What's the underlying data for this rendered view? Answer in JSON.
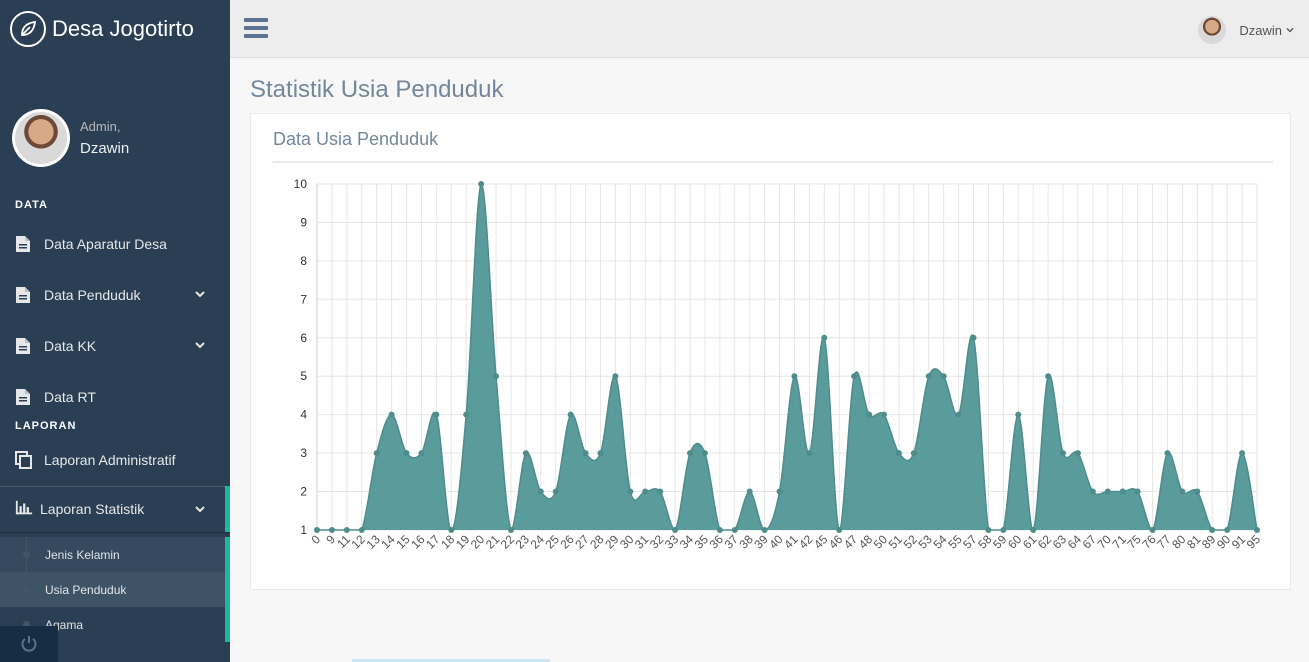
{
  "brand": {
    "name": "Desa Jogotirto"
  },
  "profile": {
    "welcome": "Admin,",
    "name": "Dzawin"
  },
  "sidebar": {
    "section_data": "DATA",
    "section_laporan": "LAPORAN",
    "items": [
      {
        "label": "Data Aparatur Desa",
        "icon": "file-icon"
      },
      {
        "label": "Data Penduduk",
        "icon": "file-icon"
      },
      {
        "label": "Data KK",
        "icon": "file-icon"
      },
      {
        "label": "Data RT",
        "icon": "file-icon"
      },
      {
        "label": "Laporan Administratif",
        "icon": "copy-icon"
      },
      {
        "label": "Laporan Statistik",
        "icon": "bar-chart-icon"
      }
    ],
    "submenu": [
      {
        "label": "Jenis Kelamin"
      },
      {
        "label": "Usia Penduduk"
      },
      {
        "label": "Agama"
      }
    ]
  },
  "topnav": {
    "user": "Dzawin"
  },
  "page": {
    "title": "Statistik Usia Penduduk",
    "panel_title": "Data Usia Penduduk"
  },
  "colors": {
    "sidebar": "#2a3f54",
    "accent": "#1ABB9C",
    "area_fill": "#5a9b9b",
    "area_line": "#4f8c8c"
  },
  "chart_data": {
    "type": "area",
    "title": "",
    "xlabel": "",
    "ylabel": "",
    "ylim": [
      1,
      10
    ],
    "yticks": [
      1,
      2,
      3,
      4,
      5,
      6,
      7,
      8,
      9,
      10
    ],
    "grid": true,
    "smooth": true,
    "x": [
      "0",
      "9",
      "11",
      "12",
      "13",
      "14",
      "15",
      "16",
      "17",
      "18",
      "19",
      "20",
      "21",
      "22",
      "23",
      "24",
      "25",
      "26",
      "27",
      "28",
      "29",
      "30",
      "31",
      "32",
      "33",
      "34",
      "35",
      "36",
      "37",
      "38",
      "39",
      "40",
      "41",
      "42",
      "45",
      "46",
      "47",
      "48",
      "50",
      "51",
      "52",
      "53",
      "54",
      "55",
      "57",
      "58",
      "59",
      "60",
      "61",
      "62",
      "63",
      "64",
      "67",
      "70",
      "71",
      "75",
      "76",
      "77",
      "80",
      "81",
      "89",
      "90",
      "91",
      "95"
    ],
    "series": [
      {
        "values": [
          1,
          1,
          1,
          1,
          3,
          4,
          3,
          3,
          4,
          1,
          4,
          10,
          5,
          1,
          3,
          2,
          2,
          4,
          3,
          3,
          5,
          2,
          2,
          2,
          1,
          3,
          3,
          1,
          1,
          2,
          1,
          2,
          5,
          3,
          6,
          1,
          5,
          4,
          4,
          3,
          3,
          5,
          5,
          4,
          6,
          1,
          1,
          4,
          1,
          5,
          3,
          3,
          2,
          2,
          2,
          2,
          1,
          3,
          2,
          2,
          1,
          1,
          3,
          1
        ]
      }
    ]
  }
}
